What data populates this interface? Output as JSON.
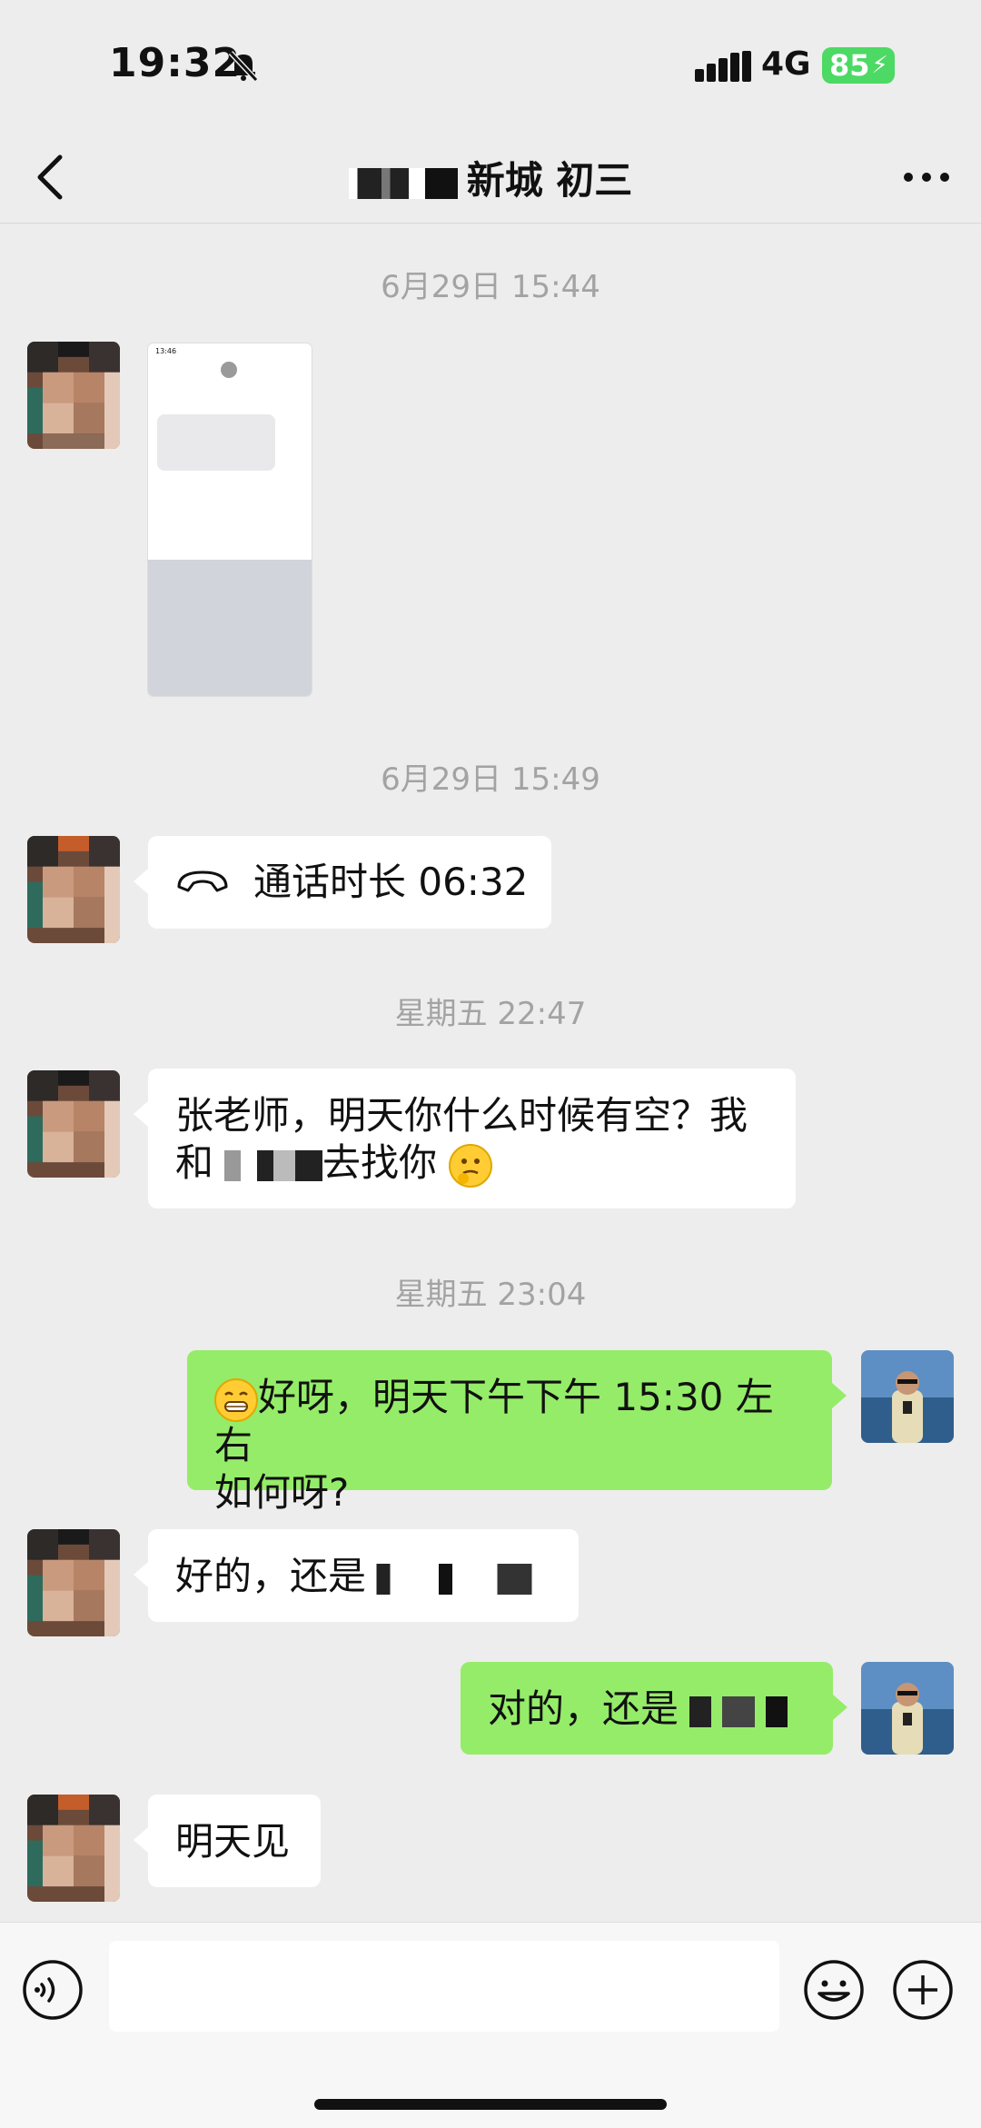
{
  "status": {
    "time": "19:32",
    "network": "4G",
    "battery": "85"
  },
  "header": {
    "title": "新城  初三"
  },
  "messages": {
    "ts1": "6月29日 15:44",
    "ts2": "6月29日 15:49",
    "call_text": "通话时长 06:32",
    "ts3": "星期五 22:47",
    "msg_zhang_line1": "张老师，明天你什么时候有空？我",
    "msg_zhang_line2_pre": "和",
    "msg_zhang_line2_post": "去找你",
    "ts4": "星期五 23:04",
    "msg_me1_line1": "好呀，明天下午下午 15:30 左右",
    "msg_me1_line2": "如何呀?",
    "msg_in2": "好的，还是",
    "msg_me2": "对的，还是",
    "msg_in3": "明天见"
  },
  "thumbnail": {
    "time": "13:46"
  },
  "icons": [
    "bell-slash-icon",
    "signal-icon",
    "back-icon",
    "more-icon",
    "phone-icon",
    "grin-emoji-icon",
    "thinking-emoji-icon",
    "voice-icon",
    "emoji-icon",
    "plus-icon"
  ],
  "colors": {
    "background": "#ededed",
    "outgoing_bubble": "#95ec69",
    "incoming_bubble": "#ffffff",
    "battery": "#4cd964",
    "timestamp": "#a3a3a3"
  }
}
